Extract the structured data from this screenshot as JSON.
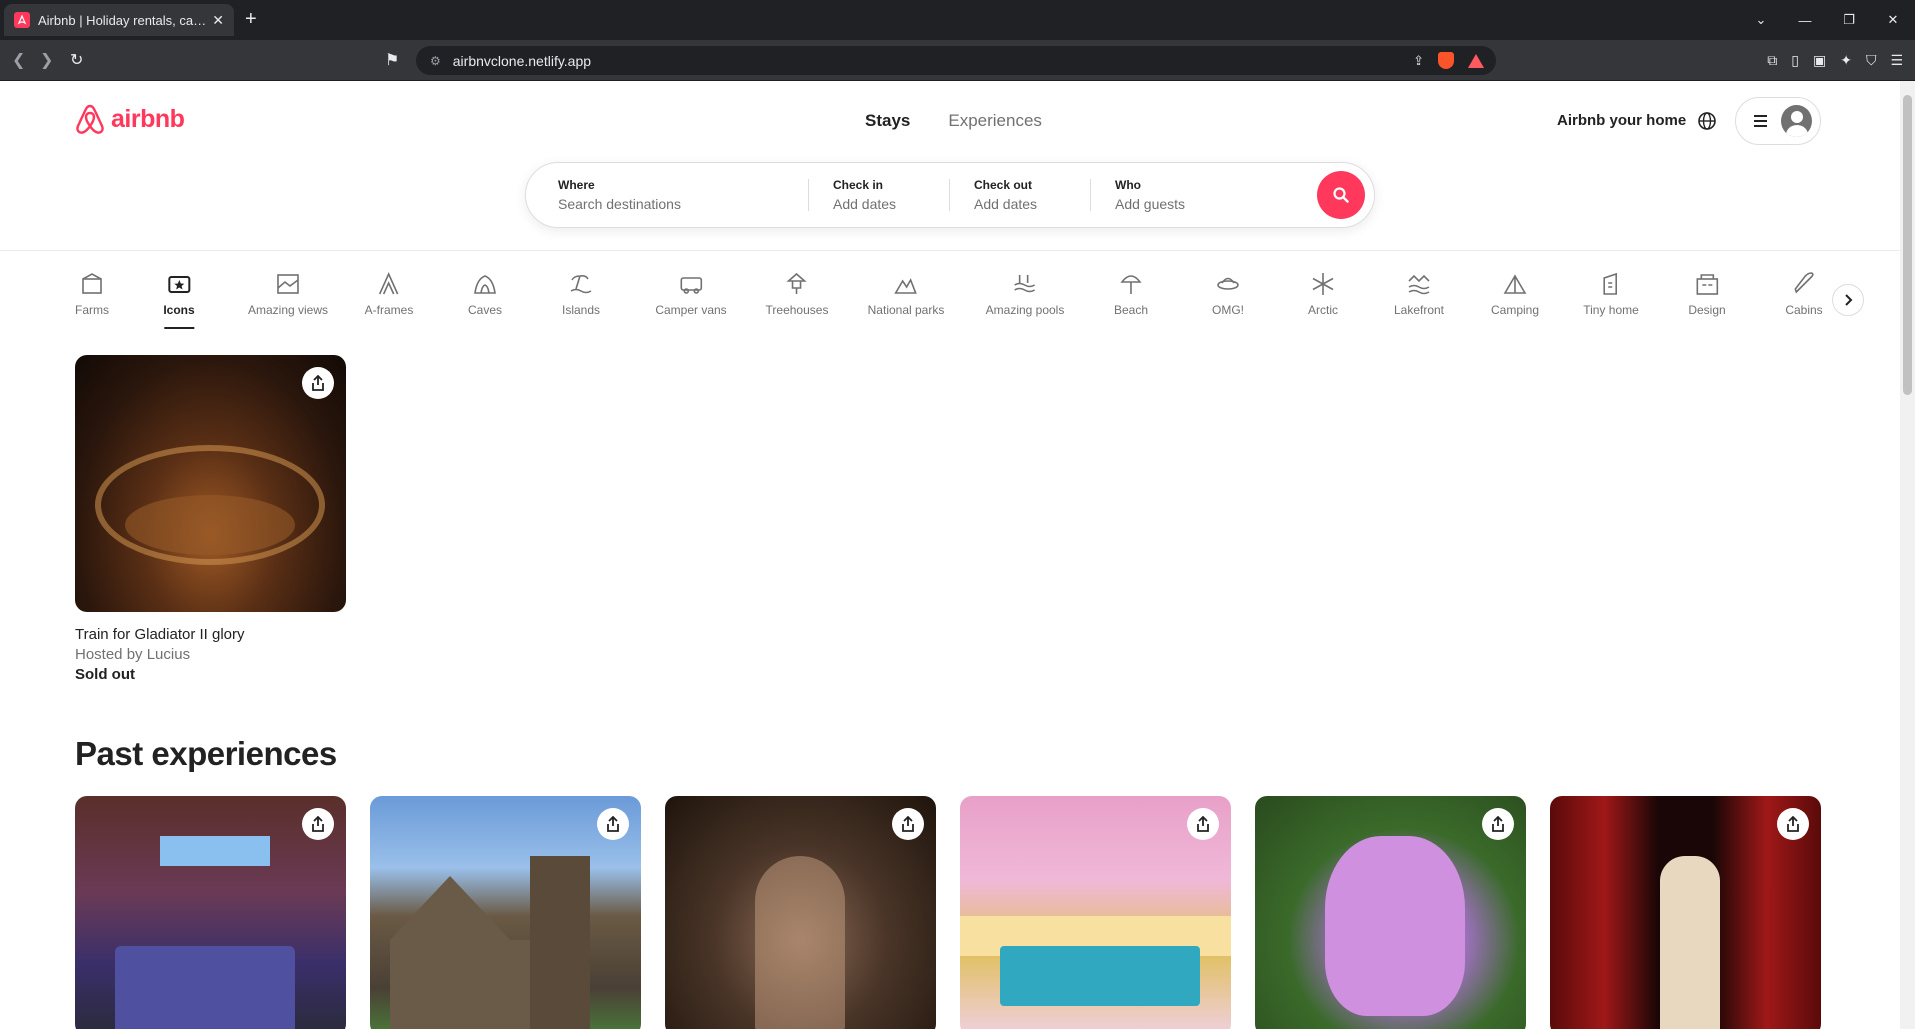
{
  "browser": {
    "tab_title": "Airbnb | Holiday rentals, cabins",
    "url": "airbnvclone.netlify.app"
  },
  "header": {
    "logo_text": "airbnb",
    "tabs": [
      "Stays",
      "Experiences"
    ],
    "host_link": "Airbnb your home"
  },
  "search": {
    "where_label": "Where",
    "where_value": "Search destinations",
    "checkin_label": "Check in",
    "checkin_value": "Add dates",
    "checkout_label": "Check out",
    "checkout_value": "Add dates",
    "who_label": "Who",
    "who_value": "Add guests"
  },
  "categories": [
    {
      "label": "Farms",
      "icon": "farm-icon"
    },
    {
      "label": "Icons",
      "icon": "icons-icon"
    },
    {
      "label": "Amazing views",
      "icon": "view-icon"
    },
    {
      "label": "A-frames",
      "icon": "aframe-icon"
    },
    {
      "label": "Caves",
      "icon": "cave-icon"
    },
    {
      "label": "Islands",
      "icon": "island-icon"
    },
    {
      "label": "Camper vans",
      "icon": "camper-icon"
    },
    {
      "label": "Treehouses",
      "icon": "treehouse-icon"
    },
    {
      "label": "National parks",
      "icon": "park-icon"
    },
    {
      "label": "Amazing pools",
      "icon": "pool-icon"
    },
    {
      "label": "Beach",
      "icon": "beach-icon"
    },
    {
      "label": "OMG!",
      "icon": "ufo-icon"
    },
    {
      "label": "Arctic",
      "icon": "snowflake-icon"
    },
    {
      "label": "Lakefront",
      "icon": "lake-icon"
    },
    {
      "label": "Camping",
      "icon": "tent-icon"
    },
    {
      "label": "Tiny home",
      "icon": "tinyhome-icon"
    },
    {
      "label": "Design",
      "icon": "design-icon"
    },
    {
      "label": "Cabins",
      "icon": "cabin-icon"
    }
  ],
  "featured": {
    "title": "Train for Gladiator II glory",
    "host": "Hosted by Lucius",
    "status": "Sold out"
  },
  "past_section_title": "Past experiences",
  "colors": {
    "brand": "#ff385c",
    "text": "#222222",
    "muted": "#717171"
  }
}
